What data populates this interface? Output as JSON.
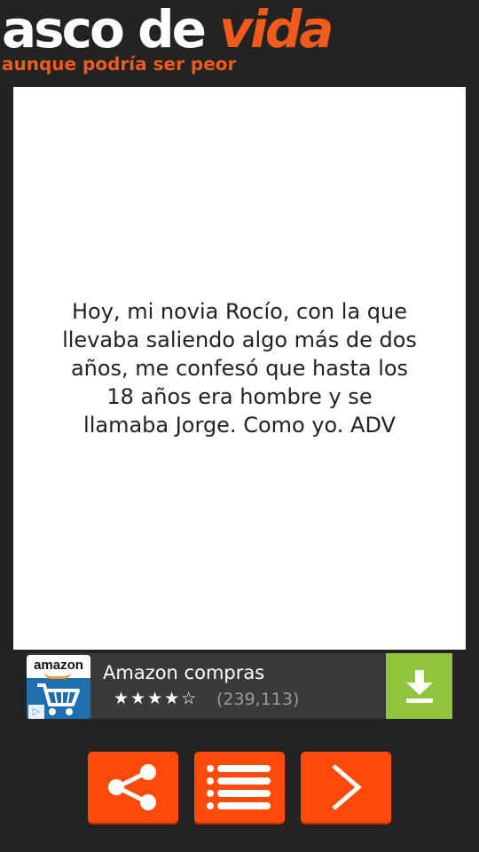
{
  "header": {
    "logo_part1": "asco de ",
    "logo_part2": "vida",
    "tagline": "aunque podría ser peor"
  },
  "story": {
    "text": "Hoy, mi novia Rocío, con la que llevaba saliendo algo más de dos años, me confesó que hasta los 18 años era hombre y se llamaba Jorge. Como yo. ADV"
  },
  "ad": {
    "brand_logo_text": "amazon",
    "title": "Amazon compras",
    "rating": 4,
    "rating_max": 5,
    "stars": "★★★★☆",
    "count": "(239,113)",
    "icon": "download-icon"
  },
  "nav": [
    {
      "name": "share-button",
      "icon": "share-icon"
    },
    {
      "name": "list-button",
      "icon": "list-icon"
    },
    {
      "name": "next-button",
      "icon": "chevron-right-icon"
    }
  ],
  "colors": {
    "background": "#232323",
    "accent": "#ff4a0a",
    "logo_orange": "#f05a1a",
    "ad_download": "#8fc43c"
  }
}
